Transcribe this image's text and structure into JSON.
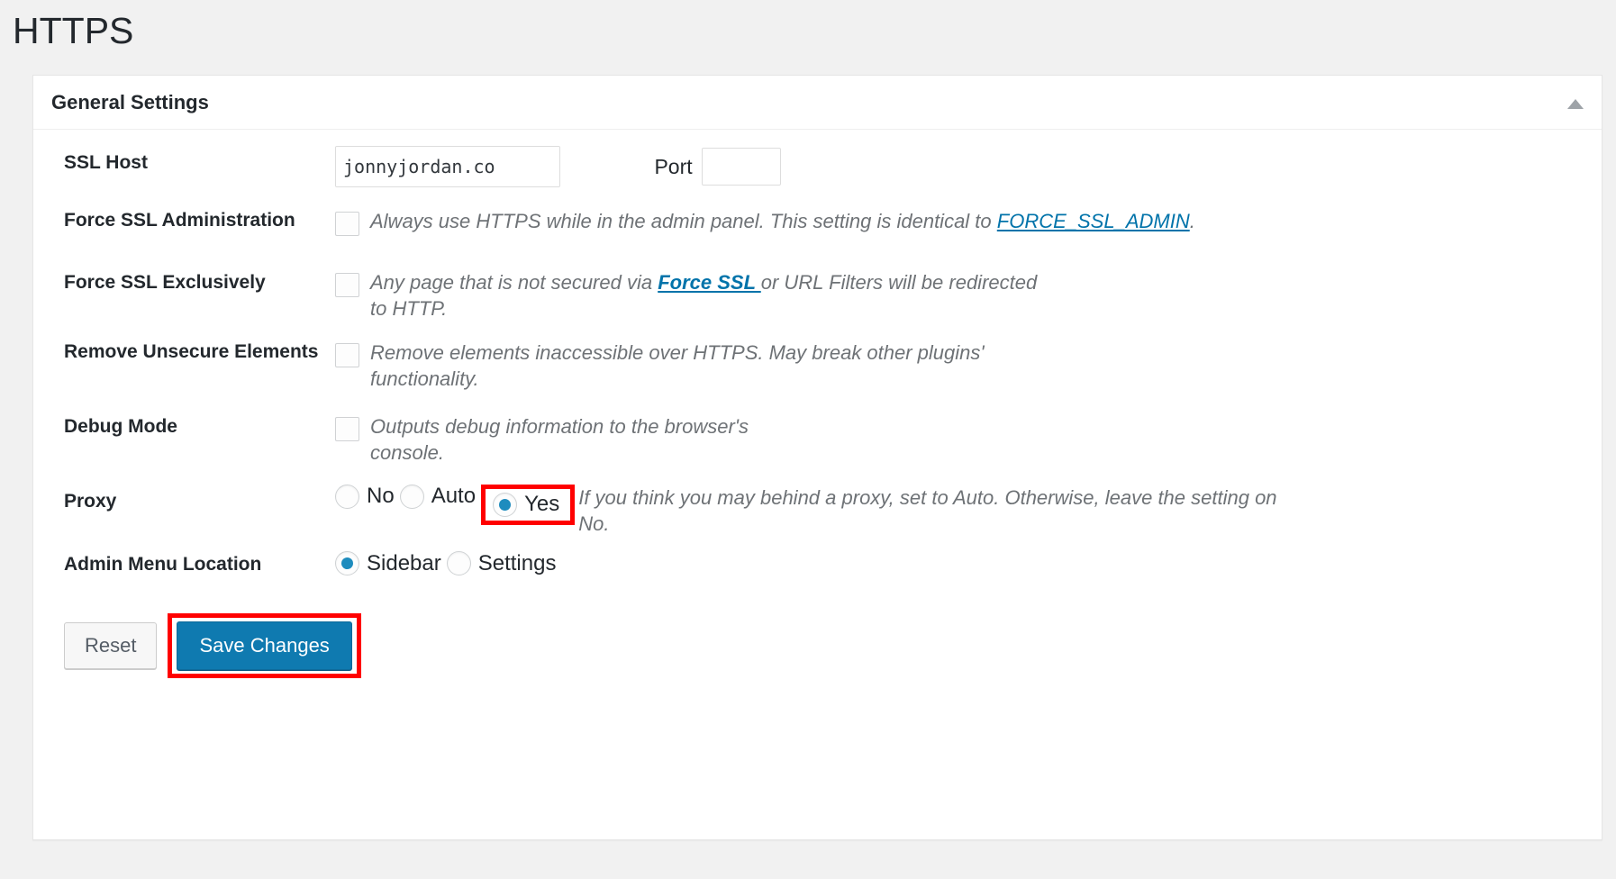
{
  "page": {
    "title": "HTTPS"
  },
  "panel": {
    "title": "General Settings",
    "toggle_icon": "chevron-up-icon"
  },
  "colors": {
    "accent_blue": "#0073aa",
    "button_blue": "#0f7ab0",
    "radio_dot": "#1e8cbe",
    "highlight_red": "#ff0000",
    "page_bg": "#f1f1f1",
    "panel_bg": "#ffffff",
    "text_dark": "#23282d",
    "text_muted": "#6e7276"
  },
  "fields": {
    "ssl_host": {
      "label": "SSL Host",
      "value": "jonnyjordan.co",
      "placeholder": ""
    },
    "port": {
      "label": "Port",
      "value": "",
      "placeholder": ""
    },
    "force_ssl_admin": {
      "label": "Force SSL Administration",
      "checked": false,
      "desc_before": "Always use HTTPS while in the admin panel. This setting is identical to ",
      "link_text": "FORCE_SSL_ADMIN",
      "desc_after": "."
    },
    "force_ssl_exclusively": {
      "label": "Force SSL Exclusively",
      "checked": false,
      "desc_before": "Any page that is not secured via ",
      "link_text": "Force SSL ",
      "desc_after": "or URL Filters will be redirected to HTTP."
    },
    "remove_unsecure_elements": {
      "label": "Remove Unsecure Elements",
      "checked": false,
      "desc": "Remove elements inaccessible over HTTPS. May break other plugins' functionality."
    },
    "debug_mode": {
      "label": "Debug Mode",
      "checked": false,
      "desc": "Outputs debug information to the browser's console."
    },
    "proxy": {
      "label": "Proxy",
      "options": [
        {
          "label": "No",
          "checked": false
        },
        {
          "label": "Auto",
          "checked": false
        },
        {
          "label": "Yes",
          "checked": true,
          "highlighted": true
        }
      ],
      "desc": "If you think you may behind a proxy, set to Auto. Otherwise, leave the setting on No."
    },
    "admin_menu_location": {
      "label": "Admin Menu Location",
      "options": [
        {
          "label": "Sidebar",
          "checked": true
        },
        {
          "label": "Settings",
          "checked": false
        }
      ]
    }
  },
  "actions": {
    "reset_label": "Reset",
    "save_label": "Save Changes",
    "save_highlighted": true
  }
}
